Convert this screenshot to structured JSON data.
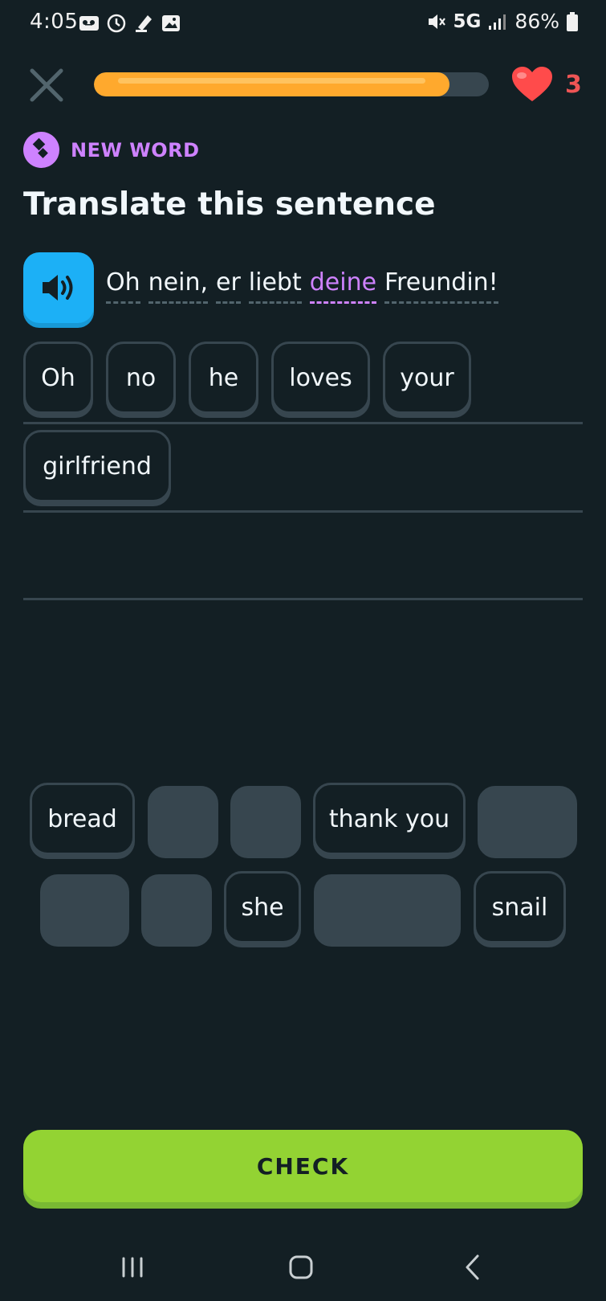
{
  "status_bar": {
    "time": "4:05",
    "network": "5G",
    "battery": "86%"
  },
  "lesson": {
    "progress_percent": 90,
    "hearts": "3",
    "badge_label": "NEW WORD",
    "title": "Translate this sentence",
    "sentence_words": [
      {
        "text": "Oh",
        "highlighted": false
      },
      {
        "text": "nein,",
        "highlighted": false
      },
      {
        "text": "er",
        "highlighted": false
      },
      {
        "text": "liebt",
        "highlighted": false
      },
      {
        "text": "deine",
        "highlighted": true
      },
      {
        "text": "Freundin!",
        "highlighted": false
      }
    ]
  },
  "answer_tiles": [
    "Oh",
    "no",
    "he",
    "loves",
    "your",
    "girlfriend"
  ],
  "word_bank": {
    "row1": [
      "bread",
      "",
      "",
      "thank you",
      ""
    ],
    "row2": [
      "",
      "",
      "she",
      "",
      "snail"
    ]
  },
  "check_label": "CHECK",
  "colors": {
    "background": "#131f24",
    "accent_purple": "#ce82ff",
    "progress": "#ffa92d",
    "check_green": "#93d333",
    "speaker_blue": "#1cb0f6",
    "heart_red": "#ff4b4b"
  }
}
